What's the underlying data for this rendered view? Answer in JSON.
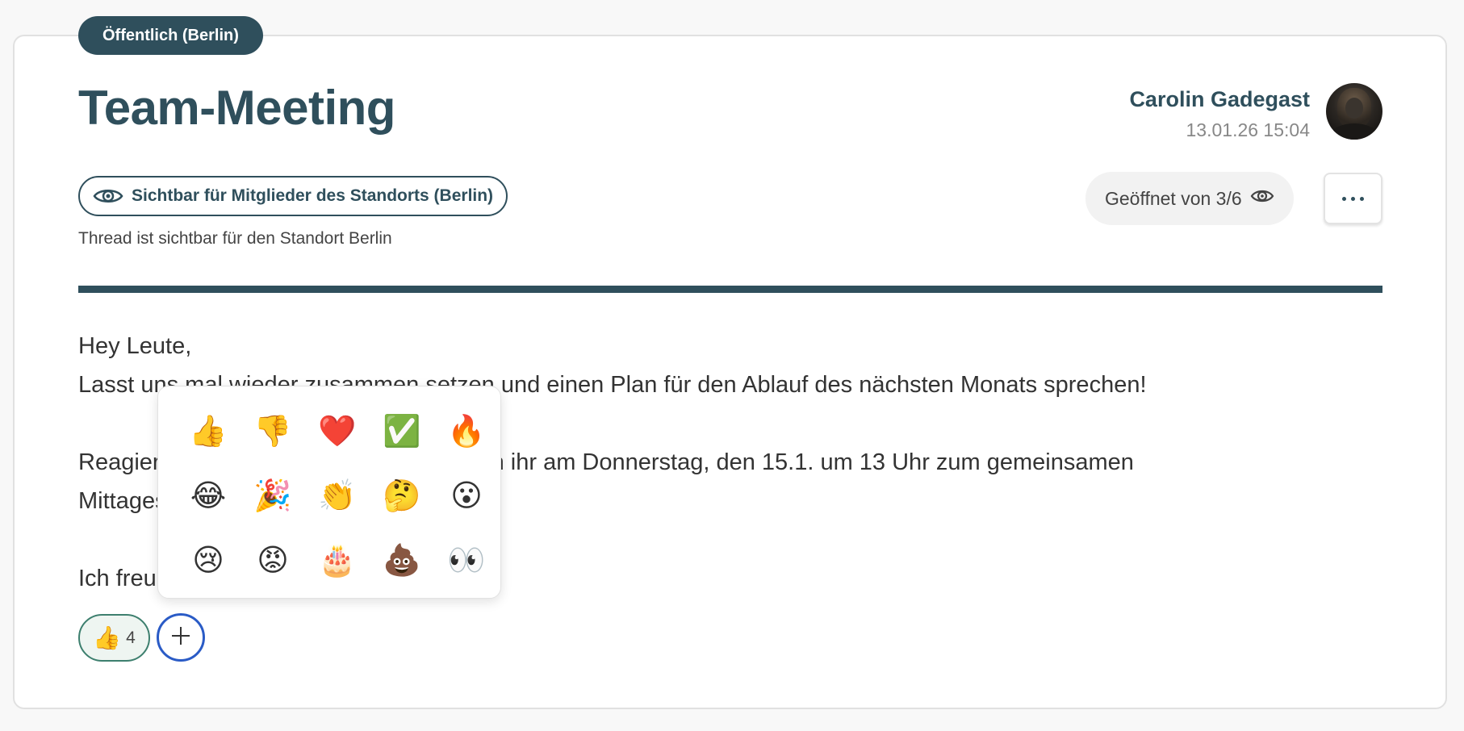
{
  "header": {
    "public_badge": "Öffentlich (Berlin)",
    "title": "Team-Meeting"
  },
  "author": {
    "name": "Carolin Gadegast",
    "date": "13.01.26 15:04"
  },
  "visibility": {
    "chip_label": "Sichtbar für Mitglieder des Standorts (Berlin)",
    "note": "Thread ist sichtbar für den Standort Berlin"
  },
  "opened": {
    "label": "Geöffnet von 3/6"
  },
  "body": {
    "line1": "Hey Leute,",
    "line2": "Lasst uns mal wieder zusammen setzen und einen Plan für den Ablauf des nächsten Monats sprechen!",
    "line3": "Reagiert mit einem 👍 hier drunter, wenn ihr am Donnerstag, den 15.1. um 13 Uhr zum gemeinsamen",
    "line4": "Mittagessen dabei seid.",
    "line5": "Ich freue mich auf euch!"
  },
  "reactions": [
    {
      "emoji": "👍",
      "count": "4"
    }
  ],
  "emoji_picker": [
    "👍",
    "👎",
    "❤️",
    "✅",
    "🔥",
    "😂",
    "🎉",
    "👏",
    "🤔",
    "😮",
    "😢",
    "😡",
    "🎂",
    "💩",
    "👀"
  ],
  "colors": {
    "primary": "#2f4f5c",
    "focus_ring": "#2a5bc6",
    "reaction_border": "#3d7f6e"
  },
  "icons": {
    "visibility": "eye-icon",
    "opened": "eye-icon",
    "more": "more-horizontal-icon",
    "add_reaction": "plus-icon"
  }
}
